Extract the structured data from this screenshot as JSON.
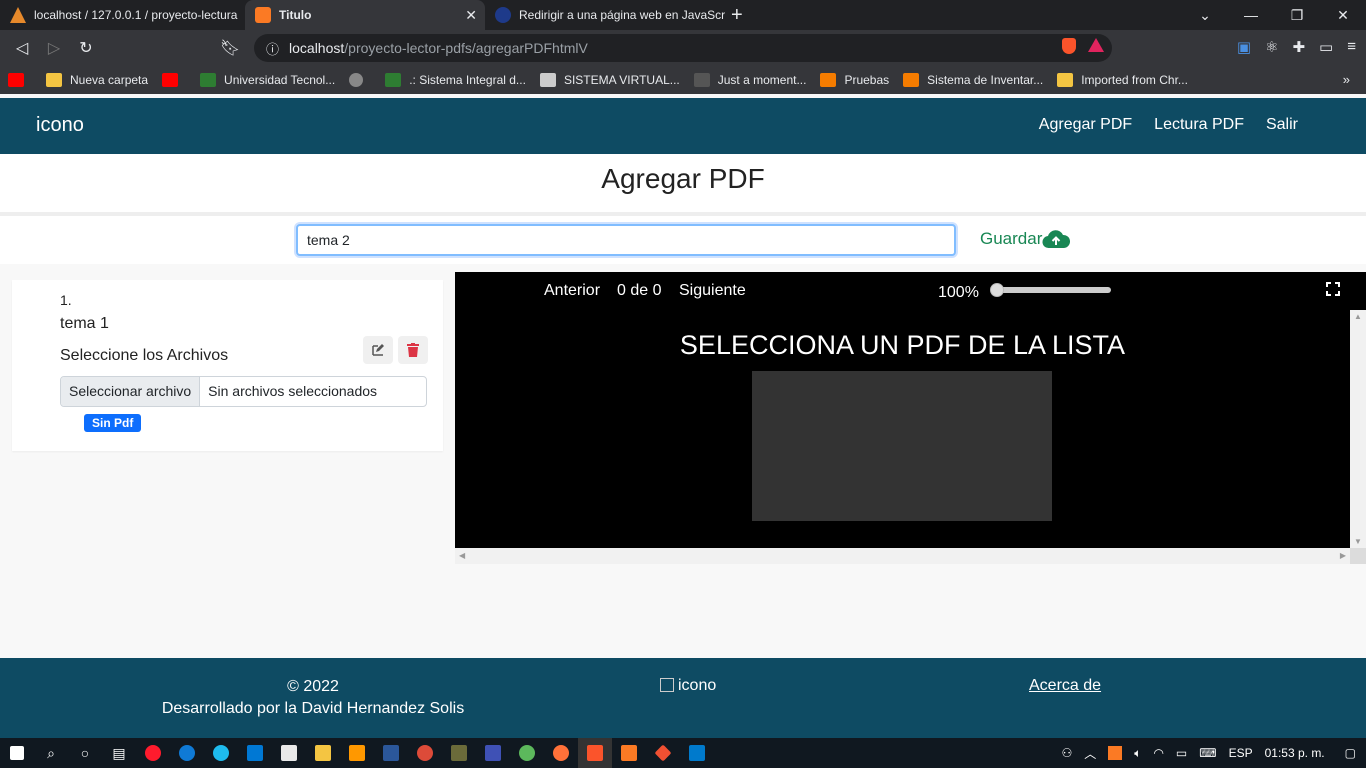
{
  "browser": {
    "tabs": [
      {
        "title": "localhost / 127.0.0.1 / proyecto-lectura"
      },
      {
        "title": "Titulo"
      },
      {
        "title": "Redirigir a una página web en JavaScri"
      }
    ],
    "url_host": "localhost",
    "url_path": "/proyecto-lector-pdfs/agregarPDFhtmlV",
    "bookmarks": [
      {
        "label": "",
        "color": "#ff0000"
      },
      {
        "label": "Nueva carpeta",
        "color": "#f4c542"
      },
      {
        "label": "",
        "color": "#ff0000"
      },
      {
        "label": "Universidad Tecnol...",
        "color": "#2e7d32"
      },
      {
        "label": "",
        "color": "#888888"
      },
      {
        "label": ".: Sistema Integral d...",
        "color": "#2e7d32"
      },
      {
        "label": "SISTEMA VIRTUAL...",
        "color": "#cccccc"
      },
      {
        "label": "Just a moment...",
        "color": "#555555"
      },
      {
        "label": "Pruebas",
        "color": "#f57c00"
      },
      {
        "label": "Sistema de Inventar...",
        "color": "#f57c00"
      },
      {
        "label": "Imported from Chr...",
        "color": "#f4c542"
      }
    ]
  },
  "nav": {
    "brand": "icono",
    "links": [
      "Agregar PDF",
      "Lectura PDF",
      "Salir"
    ]
  },
  "page_title": "Agregar PDF",
  "form": {
    "topic_value": "tema 2",
    "save_label": "Guardar"
  },
  "list": {
    "items": [
      {
        "number": "1.",
        "name": "tema 1",
        "files_label": "Seleccione los Archivos",
        "file_button": "Seleccionar archivo",
        "file_status": "Sin archivos seleccionados",
        "badge": "Sin Pdf"
      }
    ]
  },
  "viewer": {
    "prev": "Anterior",
    "page_info": "0 de 0",
    "next": "Siguiente",
    "zoom": "100%",
    "message": "SELECCIONA UN PDF DE LA LISTA"
  },
  "footer": {
    "copyright": "© 2022",
    "credit": "Desarrollado por la David Hernandez Solis",
    "logo_alt": "icono",
    "about": "Acerca de"
  },
  "taskbar": {
    "lang": "ESP",
    "time": "01:53 p. m."
  }
}
